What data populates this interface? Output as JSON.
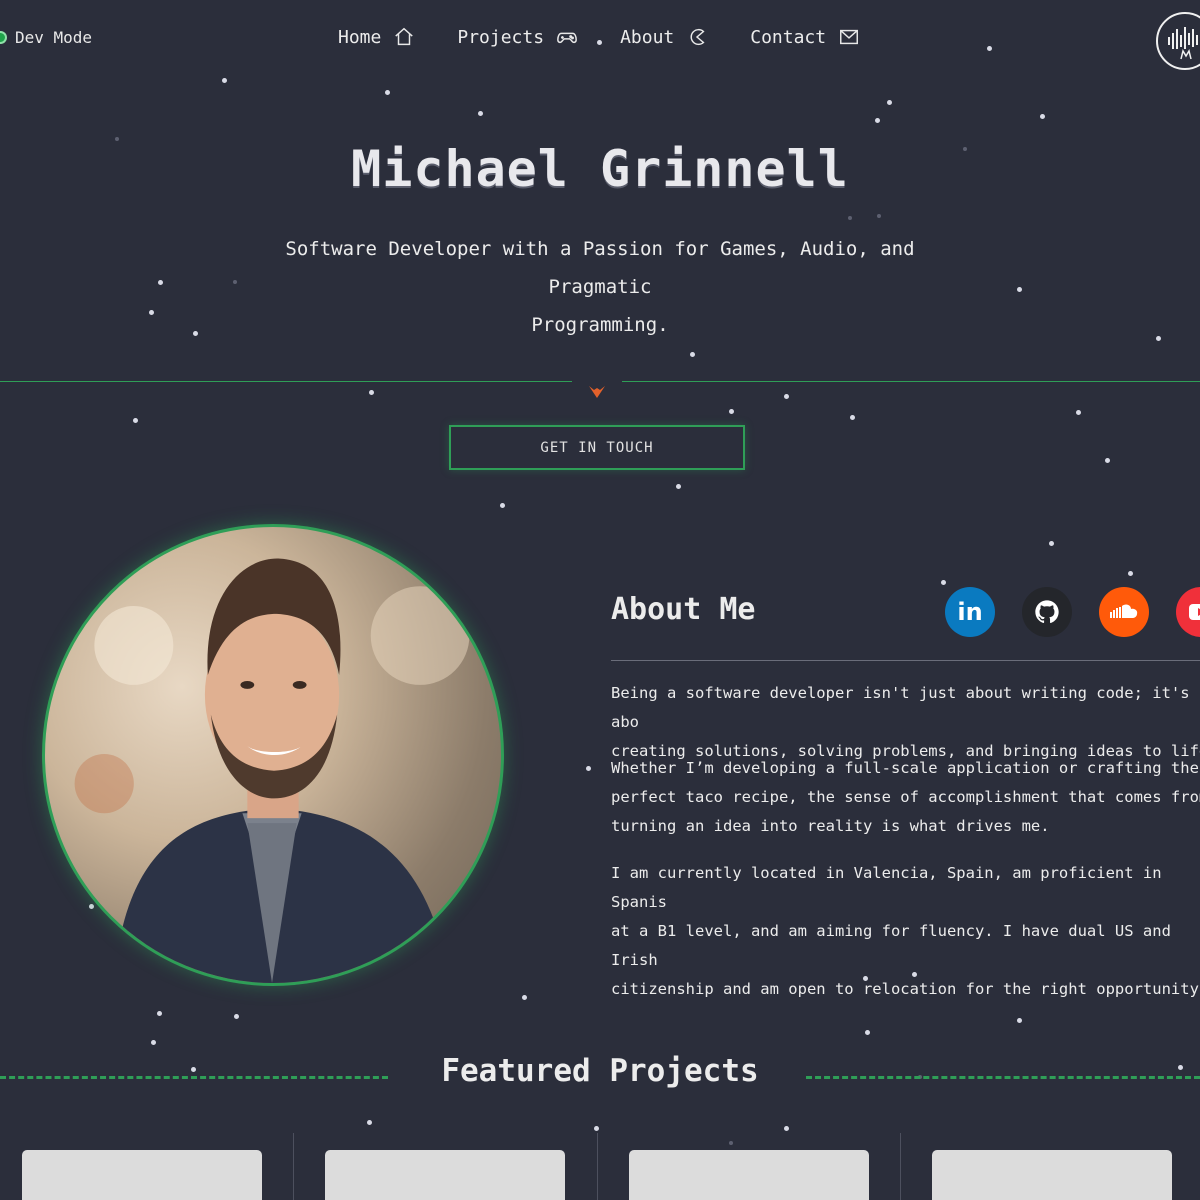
{
  "devmode": {
    "label": "Dev Mode"
  },
  "nav": {
    "items": [
      {
        "label": "Home",
        "icon": "home-icon"
      },
      {
        "label": "Projects",
        "icon": "gamepad-icon"
      },
      {
        "label": "About",
        "icon": "pacman-icon"
      },
      {
        "label": "Contact",
        "icon": "mail-icon"
      }
    ]
  },
  "hero": {
    "name": "Michael Grinnell",
    "subtitle_line1": "Software Developer with a Passion for Games, Audio, and Pragmatic",
    "subtitle_line2": "Programming.",
    "cta_label": "GET IN TOUCH"
  },
  "about": {
    "title": "About Me",
    "social": [
      {
        "name": "LinkedIn",
        "glyph": "in",
        "color": "#0a7ac0"
      },
      {
        "name": "GitHub",
        "glyph": "github-icon",
        "color": "#24262b"
      },
      {
        "name": "SoundCloud",
        "glyph": "soundcloud-icon",
        "color": "#ff5a0a"
      },
      {
        "name": "YouTube",
        "glyph": "youtube-icon",
        "color": "#f0303a"
      }
    ],
    "p1": "Being a software developer isn't just about writing code; it's abo\ncreating solutions, solving problems, and bringing ideas to life!",
    "p2": "Whether I’m developing a full-scale application or crafting the\nperfect taco recipe, the sense of accomplishment that comes from\nturning an idea into reality is what drives me.",
    "p3": "I am currently located in Valencia, Spain, am proficient in Spanis\nat a B1 level, and am aiming for fluency. I have dual US and Irish\ncitizenship and am open to relocation for the right opportunity."
  },
  "featured": {
    "title": "Featured Projects"
  },
  "colors": {
    "background": "#2b2e3b",
    "accent": "#2f9e57"
  }
}
